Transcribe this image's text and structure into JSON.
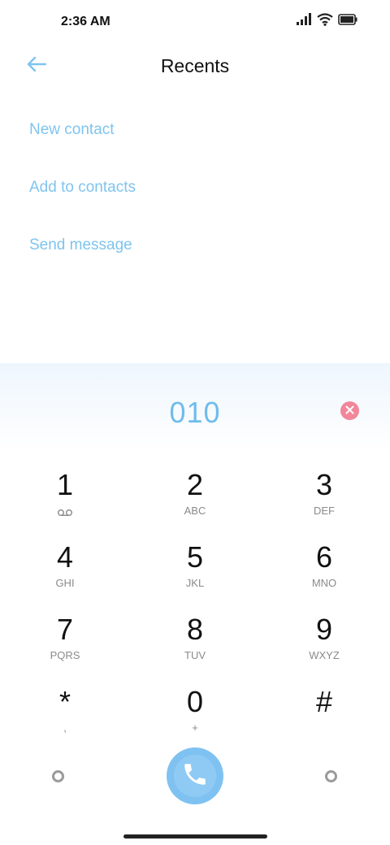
{
  "status_bar": {
    "time": "2:36 AM",
    "icons": [
      "signal-icon",
      "wifi-icon",
      "battery-icon"
    ]
  },
  "header": {
    "title": "Recents",
    "back_icon": "arrow-left-icon"
  },
  "actions": [
    {
      "label": "New contact"
    },
    {
      "label": "Add to contacts"
    },
    {
      "label": "Send message"
    }
  ],
  "dialer": {
    "number": "010",
    "keys": [
      {
        "digit": "1",
        "letters": ""
      },
      {
        "digit": "2",
        "letters": "ABC"
      },
      {
        "digit": "3",
        "letters": "DEF"
      },
      {
        "digit": "4",
        "letters": "GHI"
      },
      {
        "digit": "5",
        "letters": "JKL"
      },
      {
        "digit": "6",
        "letters": "MNO"
      },
      {
        "digit": "7",
        "letters": "PQRS"
      },
      {
        "digit": "8",
        "letters": "TUV"
      },
      {
        "digit": "9",
        "letters": "WXYZ"
      },
      {
        "digit": "*",
        "letters": ","
      },
      {
        "digit": "0",
        "letters": "+"
      },
      {
        "digit": "#",
        "letters": ""
      }
    ]
  },
  "colors": {
    "accent": "#7fc4ee",
    "number": "#6fbcec",
    "clear": "#f1879a",
    "call": "#7fc2f2"
  }
}
